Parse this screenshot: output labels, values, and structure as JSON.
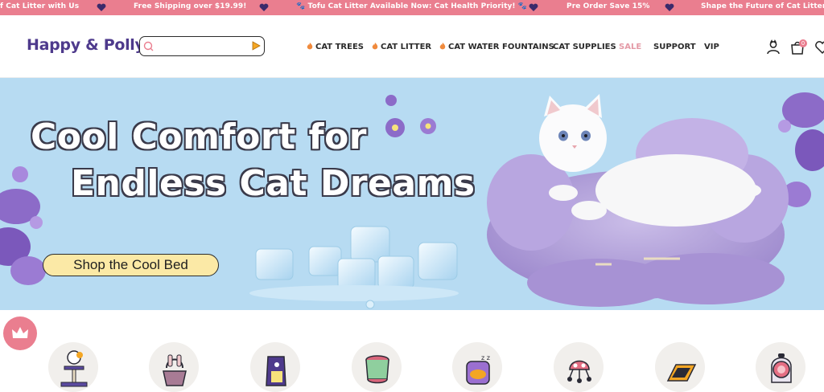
{
  "announcement": {
    "items": [
      "f Cat Litter with Us",
      "Free Shipping over $19.99!",
      "🐾 Tofu Cat Litter Available Now: Cat Health Priority! 🐾",
      "Pre Order Save 15%",
      "Shape the Future of Cat Litter wi"
    ],
    "icon": "heart-icon"
  },
  "header": {
    "logo": "Happy & Polly",
    "search": {
      "value": "",
      "placeholder": ""
    },
    "nav": [
      {
        "label": "CAT TREES",
        "icon": "flame-icon"
      },
      {
        "label": "CAT LITTER",
        "icon": "flame-icon"
      },
      {
        "label": "CAT WATER FOUNTAINS",
        "icon": "flame-icon"
      },
      {
        "label": "CAT SUPPLIES"
      },
      {
        "label": "SALE"
      },
      {
        "label": "SUPPORT"
      },
      {
        "label": "VIP"
      }
    ],
    "cart_count": "0",
    "icons": [
      "account-icon",
      "cart-icon",
      "wishlist-heart-icon"
    ]
  },
  "hero": {
    "title_line1": "Cool Comfort for",
    "title_line2": "Endless Cat Dreams",
    "cta": "Shop the Cool Bed"
  },
  "categories": [
    "cat-tree-icon",
    "litter-box-icon",
    "litter-bag-icon",
    "water-fountain-icon",
    "cat-bed-icon",
    "smart-feeder-icon",
    "scratcher-icon",
    "cat-backpack-icon"
  ],
  "colors": {
    "brand_pink": "#ea7e8f",
    "brand_purple": "#4e3a8c",
    "hero_bg": "#b7dbf2",
    "cta_bg": "#fbe9a6",
    "sale": "#e49aa6"
  }
}
